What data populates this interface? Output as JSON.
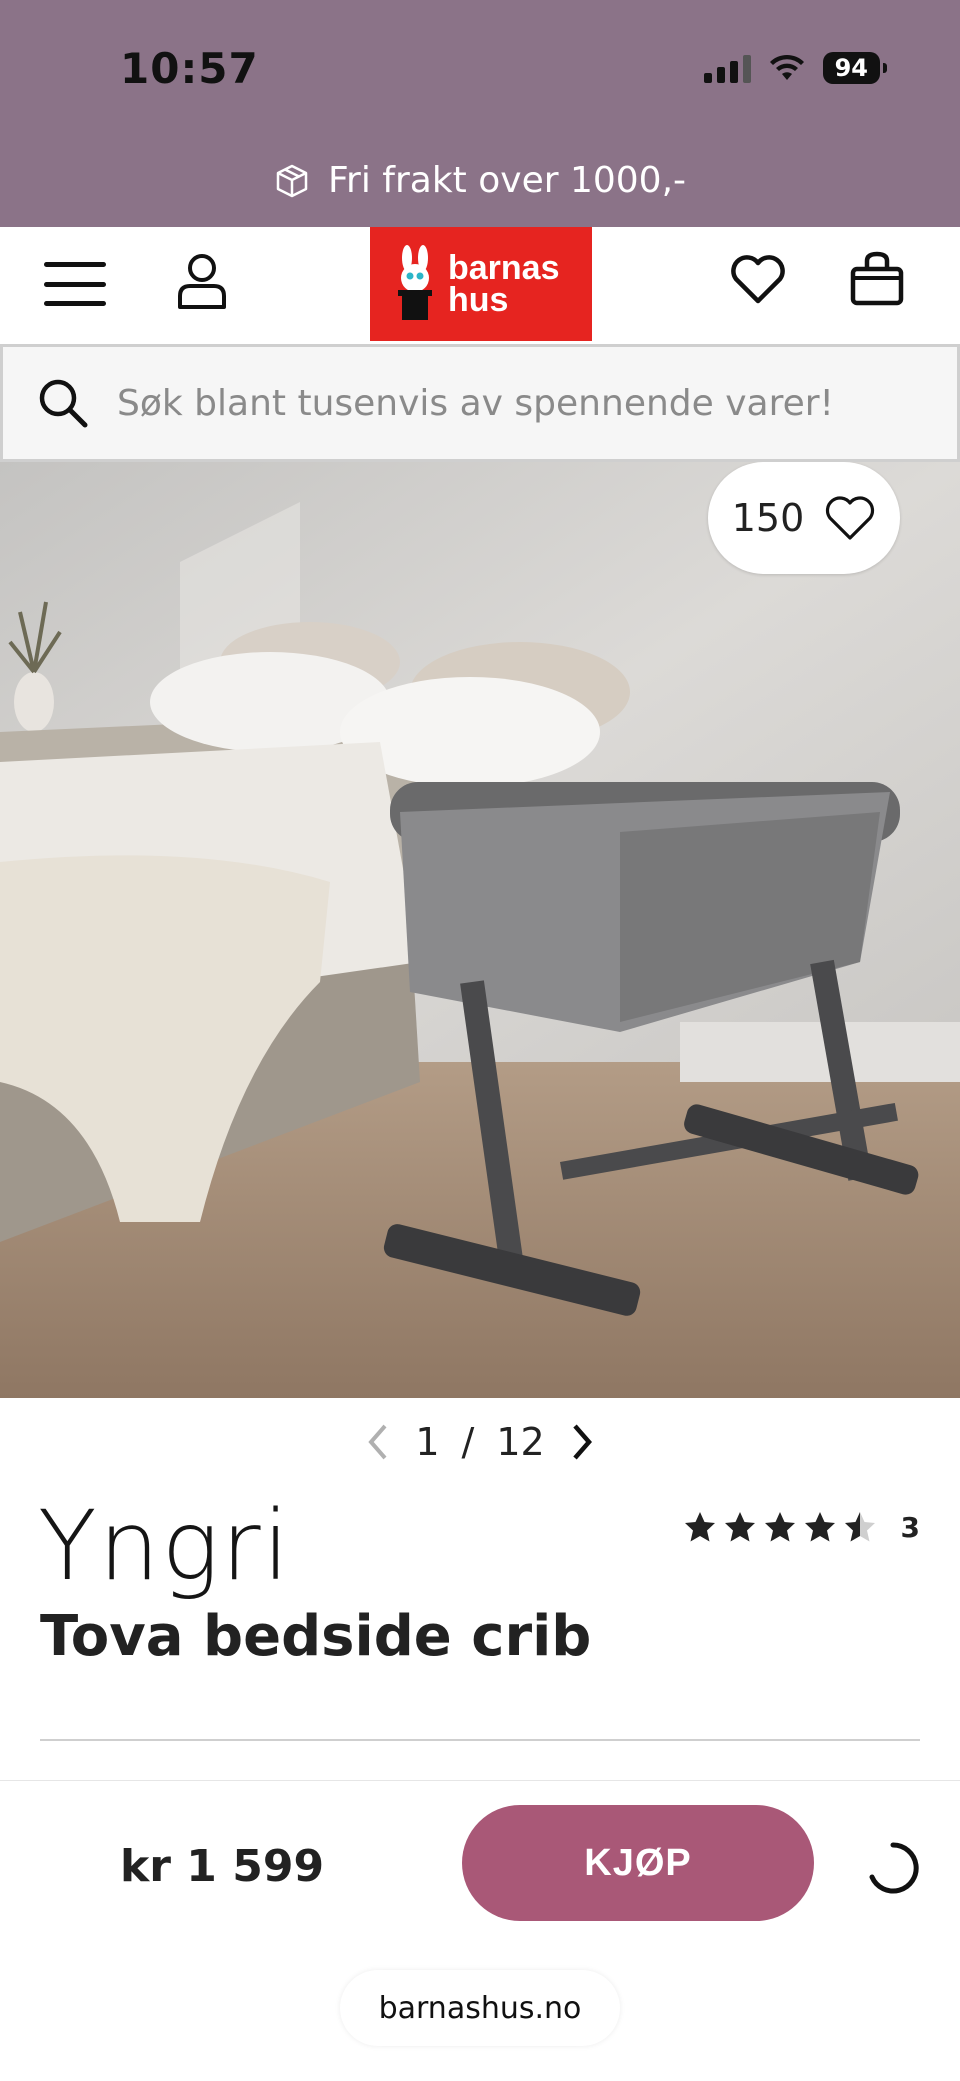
{
  "status_bar": {
    "time": "10:57",
    "battery": "94"
  },
  "promo": {
    "text": "Fri frakt over 1000,-",
    "icon": "package-icon"
  },
  "header": {
    "logo_line1": "barnas",
    "logo_line2": "hus",
    "menu_icon": "menu-icon",
    "account_icon": "user-icon",
    "wishlist_icon": "heart-icon",
    "cart_icon": "shopping-bag-icon"
  },
  "search": {
    "placeholder": "Søk blant tusenvis av spennende varer!"
  },
  "product_image": {
    "favorites_count": "150"
  },
  "pager": {
    "current": "1",
    "separator": "/",
    "total": "12"
  },
  "product": {
    "brand": "Yngri",
    "title": "Tova bedside crib",
    "rating": 4.5,
    "rating_count": "3",
    "price": "kr 1 599"
  },
  "buy": {
    "label": "KJØP"
  },
  "browser": {
    "url": "barnashus.no"
  },
  "colors": {
    "accent": "#a95877",
    "promo_band": "#8b7388",
    "logo_red": "#e62420"
  }
}
